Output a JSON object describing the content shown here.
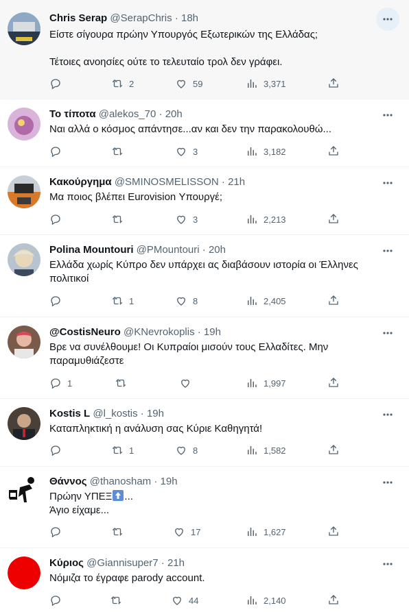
{
  "colors": {
    "muted": "#536471",
    "border": "#eff3f4",
    "highlight": "#f7f7f7"
  },
  "tweets": [
    {
      "name": "Chris Serap",
      "handle": "@SerapChris",
      "time": "18h",
      "lines": [
        "Είστε σίγουρα πρώην Υπουργός Εξωτερικών της Ελλάδας;",
        "",
        "Τέτοιες ανοησίες ούτε το τελευταίο τρολ δεν γράφει."
      ],
      "replies": "",
      "retweets": "2",
      "likes": "59",
      "views": "3,371"
    },
    {
      "name": "Το τίποτα",
      "handle": "@alekos_70",
      "time": "20h",
      "lines": [
        "Ναι αλλά ο κόσμος απάντησε...αν και δεν την παρακολουθώ..."
      ],
      "replies": "",
      "retweets": "",
      "likes": "3",
      "views": "3,182"
    },
    {
      "name": "Κακούργημα",
      "handle": "@SMINOSMELISSON",
      "time": "21h",
      "lines": [
        "Μα ποιος βλέπει Eurovision Υπουργέ;"
      ],
      "replies": "",
      "retweets": "",
      "likes": "3",
      "views": "2,213"
    },
    {
      "name": "Polina Mountouri",
      "handle": "@PMountouri",
      "time": "20h",
      "lines": [
        "Ελλάδα χωρίς Κύπρο δεν υπάρχει ας διαβάσουν ιστορία οι Έλληνες",
        "πολιτικοί"
      ],
      "replies": "",
      "retweets": "1",
      "likes": "8",
      "views": "2,405"
    },
    {
      "name": "@CostisNeuro",
      "handle": "@KNevrokoplis",
      "time": "19h",
      "lines": [
        "Βρε να συνέλθουμε! Οι Κυπραίοι μισούν τους Ελλαδίτες. Μην",
        "παραμυθιάζεστε"
      ],
      "replies": "1",
      "retweets": "",
      "likes": "",
      "views": "1,997"
    },
    {
      "name": "Kostis L",
      "handle": "@l_kostis",
      "time": "19h",
      "lines": [
        "Καταπληκτική η ανάλυση σας Κύριε Καθηγητά!"
      ],
      "replies": "",
      "retweets": "1",
      "likes": "8",
      "views": "1,582"
    },
    {
      "name": "Θάννος",
      "handle": "@thanosham",
      "time": "19h",
      "line1_before": "Πρώην ΥΠΕΞ",
      "line1_after": "...",
      "emoji": "up-arrow-emoji",
      "lines": [
        "",
        "Άγιο είχαμε..."
      ],
      "replies": "",
      "retweets": "",
      "likes": "17",
      "views": "1,627"
    },
    {
      "name": "Κύριος",
      "handle": "@Giannisuper7",
      "time": "21h",
      "lines": [
        "Νόμιζα το έγραφε parody account."
      ],
      "replies": "",
      "retweets": "",
      "likes": "44",
      "views": "2,140"
    }
  ]
}
